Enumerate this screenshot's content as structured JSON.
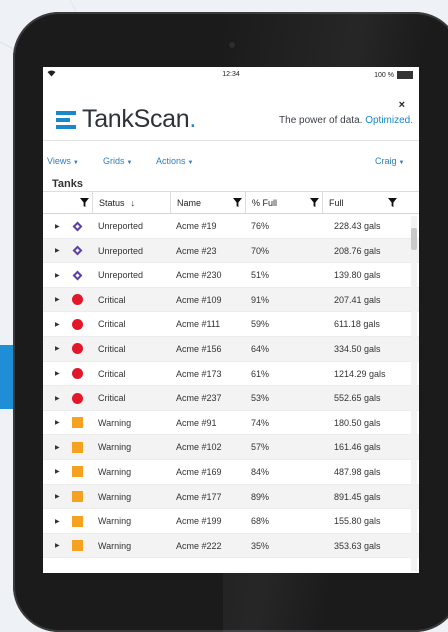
{
  "status_bar": {
    "time": "12:34",
    "battery": "100 %"
  },
  "header": {
    "logo_main": "TankScan",
    "logo_dot": ".",
    "tagline": "The power of data. ",
    "tagline_accent": "Optimized.",
    "close_label": "×"
  },
  "nav": {
    "views": "Views",
    "grids": "Grids",
    "actions": "Actions",
    "user": "Craig"
  },
  "section_title": "Tanks",
  "columns": {
    "status": "Status",
    "sort_indicator": "↓",
    "name": "Name",
    "pct_full": "% Full",
    "full": "Full"
  },
  "colors": {
    "accent": "#1a87c9",
    "unreported": "#5b3ea6",
    "critical": "#e3172a",
    "warning": "#f4a21f"
  },
  "rows": [
    {
      "icon": "diamond",
      "status": "Unreported",
      "name": "Acme #19",
      "pct": "76%",
      "full": "228.43 gals"
    },
    {
      "icon": "diamond",
      "status": "Unreported",
      "name": "Acme #23",
      "pct": "70%",
      "full": "208.76 gals"
    },
    {
      "icon": "diamond",
      "status": "Unreported",
      "name": "Acme #230",
      "pct": "51%",
      "full": "139.80 gals"
    },
    {
      "icon": "circle",
      "status": "Critical",
      "name": "Acme #109",
      "pct": "91%",
      "full": "207.41 gals"
    },
    {
      "icon": "circle",
      "status": "Critical",
      "name": "Acme #111",
      "pct": "59%",
      "full": "611.18 gals"
    },
    {
      "icon": "circle",
      "status": "Critical",
      "name": "Acme #156",
      "pct": "64%",
      "full": "334.50 gals"
    },
    {
      "icon": "circle",
      "status": "Critical",
      "name": "Acme #173",
      "pct": "61%",
      "full": "1214.29 gals"
    },
    {
      "icon": "circle",
      "status": "Critical",
      "name": "Acme #237",
      "pct": "53%",
      "full": "552.65 gals"
    },
    {
      "icon": "square",
      "status": "Warning",
      "name": "Acme #91",
      "pct": "74%",
      "full": "180.50 gals"
    },
    {
      "icon": "square",
      "status": "Warning",
      "name": "Acme #102",
      "pct": "57%",
      "full": "161.46 gals"
    },
    {
      "icon": "square",
      "status": "Warning",
      "name": "Acme #169",
      "pct": "84%",
      "full": "487.98 gals"
    },
    {
      "icon": "square",
      "status": "Warning",
      "name": "Acme #177",
      "pct": "89%",
      "full": "891.45 gals"
    },
    {
      "icon": "square",
      "status": "Warning",
      "name": "Acme #199",
      "pct": "68%",
      "full": "155.80 gals"
    },
    {
      "icon": "square",
      "status": "Warning",
      "name": "Acme #222",
      "pct": "35%",
      "full": "353.63 gals"
    }
  ]
}
